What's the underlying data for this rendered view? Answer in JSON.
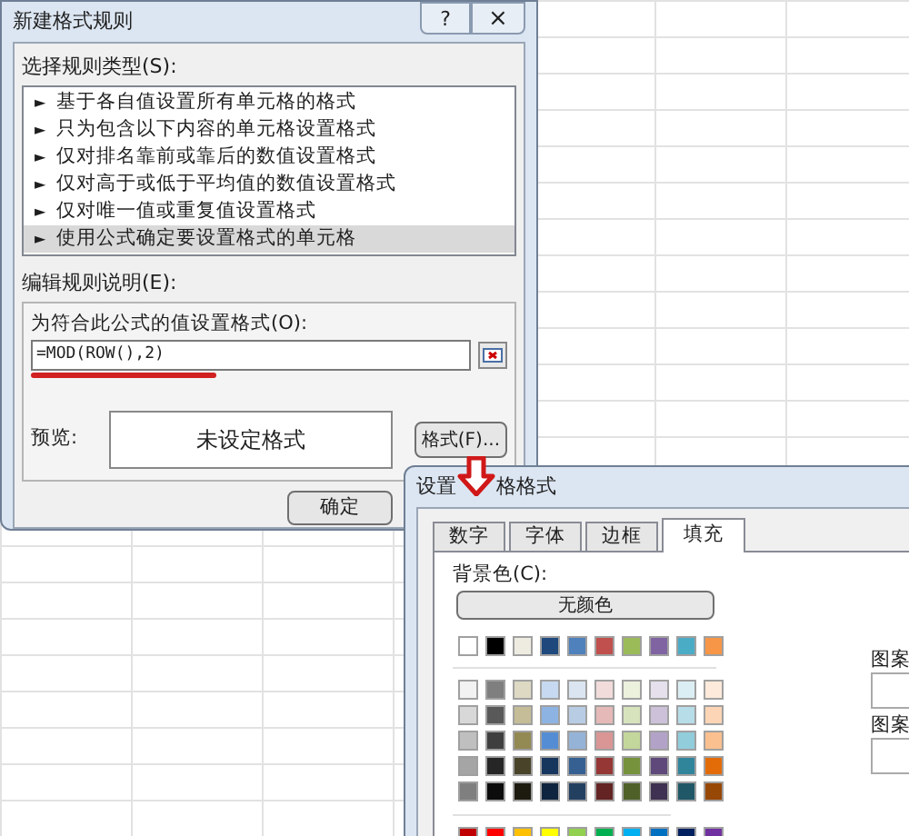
{
  "rule_dialog": {
    "title": "新建格式规则",
    "help": "?",
    "close": "×",
    "type_label": "选择规则类型(S):",
    "rule_types": [
      {
        "label": "基于各自值设置所有单元格的格式",
        "selected": false
      },
      {
        "label": "只为包含以下内容的单元格设置格式",
        "selected": false
      },
      {
        "label": "仅对排名靠前或靠后的数值设置格式",
        "selected": false
      },
      {
        "label": "仅对高于或低于平均值的数值设置格式",
        "selected": false
      },
      {
        "label": "仅对唯一值或重复值设置格式",
        "selected": false
      },
      {
        "label": "使用公式确定要设置格式的单元格",
        "selected": true
      }
    ],
    "bullet": "►",
    "edit_label": "编辑规则说明(E):",
    "formula_label": "为符合此公式的值设置格式(O):",
    "formula": "=MOD(ROW(),2)",
    "preview_label": "预览:",
    "preview_text": "未设定格式",
    "format_button": "格式(F)...",
    "ok_button": "确定"
  },
  "format_dialog": {
    "title_start": "设置",
    "title_end": "格格式",
    "tabs": [
      {
        "label": "数字",
        "selected": false
      },
      {
        "label": "字体",
        "selected": false
      },
      {
        "label": "边框",
        "selected": false
      },
      {
        "label": "填充",
        "selected": true
      }
    ],
    "background_label": "背景色(C):",
    "no_color_button": "无颜色",
    "theme_colors": [
      {
        "color": "#ffffff"
      },
      {
        "color": "#000000"
      },
      {
        "color": "#eeece1"
      },
      {
        "color": "#1f497d"
      },
      {
        "color": "#4f81bd"
      },
      {
        "color": "#c0504d"
      },
      {
        "color": "#9bbb59"
      },
      {
        "color": "#8064a2"
      },
      {
        "color": "#4bacc6"
      },
      {
        "color": "#f79646"
      }
    ],
    "tint_rows": [
      [
        {
          "color": "#f2f2f2"
        },
        {
          "color": "#7f7f7f"
        },
        {
          "color": "#ddd9c3"
        },
        {
          "color": "#c6d9f0"
        },
        {
          "color": "#dbe5f1"
        },
        {
          "color": "#f2dcdb"
        },
        {
          "color": "#ebf1dd"
        },
        {
          "color": "#e5e0ec"
        },
        {
          "color": "#dbeef3"
        },
        {
          "color": "#fdeada"
        }
      ],
      [
        {
          "color": "#d8d8d8"
        },
        {
          "color": "#595959"
        },
        {
          "color": "#c4bd97"
        },
        {
          "color": "#8db3e2"
        },
        {
          "color": "#b8cce4"
        },
        {
          "color": "#e5b9b7"
        },
        {
          "color": "#d7e3bc"
        },
        {
          "color": "#ccc1d9"
        },
        {
          "color": "#b7dde8"
        },
        {
          "color": "#fbd5b5"
        }
      ],
      [
        {
          "color": "#bfbfbf"
        },
        {
          "color": "#3f3f3f"
        },
        {
          "color": "#938953"
        },
        {
          "color": "#548dd4"
        },
        {
          "color": "#95b3d7"
        },
        {
          "color": "#d99694"
        },
        {
          "color": "#c3d69b"
        },
        {
          "color": "#b2a2c7"
        },
        {
          "color": "#92cddc"
        },
        {
          "color": "#fac08f"
        }
      ],
      [
        {
          "color": "#a5a5a5"
        },
        {
          "color": "#262626"
        },
        {
          "color": "#494429"
        },
        {
          "color": "#17365d"
        },
        {
          "color": "#366092"
        },
        {
          "color": "#953734"
        },
        {
          "color": "#76923c"
        },
        {
          "color": "#5f497a"
        },
        {
          "color": "#31859b"
        },
        {
          "color": "#e36c09"
        }
      ],
      [
        {
          "color": "#7f7f7f"
        },
        {
          "color": "#0c0c0c"
        },
        {
          "color": "#1d1b10"
        },
        {
          "color": "#0f243e"
        },
        {
          "color": "#244061"
        },
        {
          "color": "#632423"
        },
        {
          "color": "#4f6128"
        },
        {
          "color": "#3f3151"
        },
        {
          "color": "#205867"
        },
        {
          "color": "#974806"
        }
      ]
    ],
    "standard_colors": [
      {
        "color": "#c00000"
      },
      {
        "color": "#ff0000"
      },
      {
        "color": "#ffc000"
      },
      {
        "color": "#ffff00"
      },
      {
        "color": "#92d050"
      },
      {
        "color": "#00b050"
      },
      {
        "color": "#00b0f0"
      },
      {
        "color": "#0070c0"
      },
      {
        "color": "#002060"
      },
      {
        "color": "#7030a0"
      }
    ],
    "pattern_labels": [
      "图案",
      "图案"
    ]
  }
}
